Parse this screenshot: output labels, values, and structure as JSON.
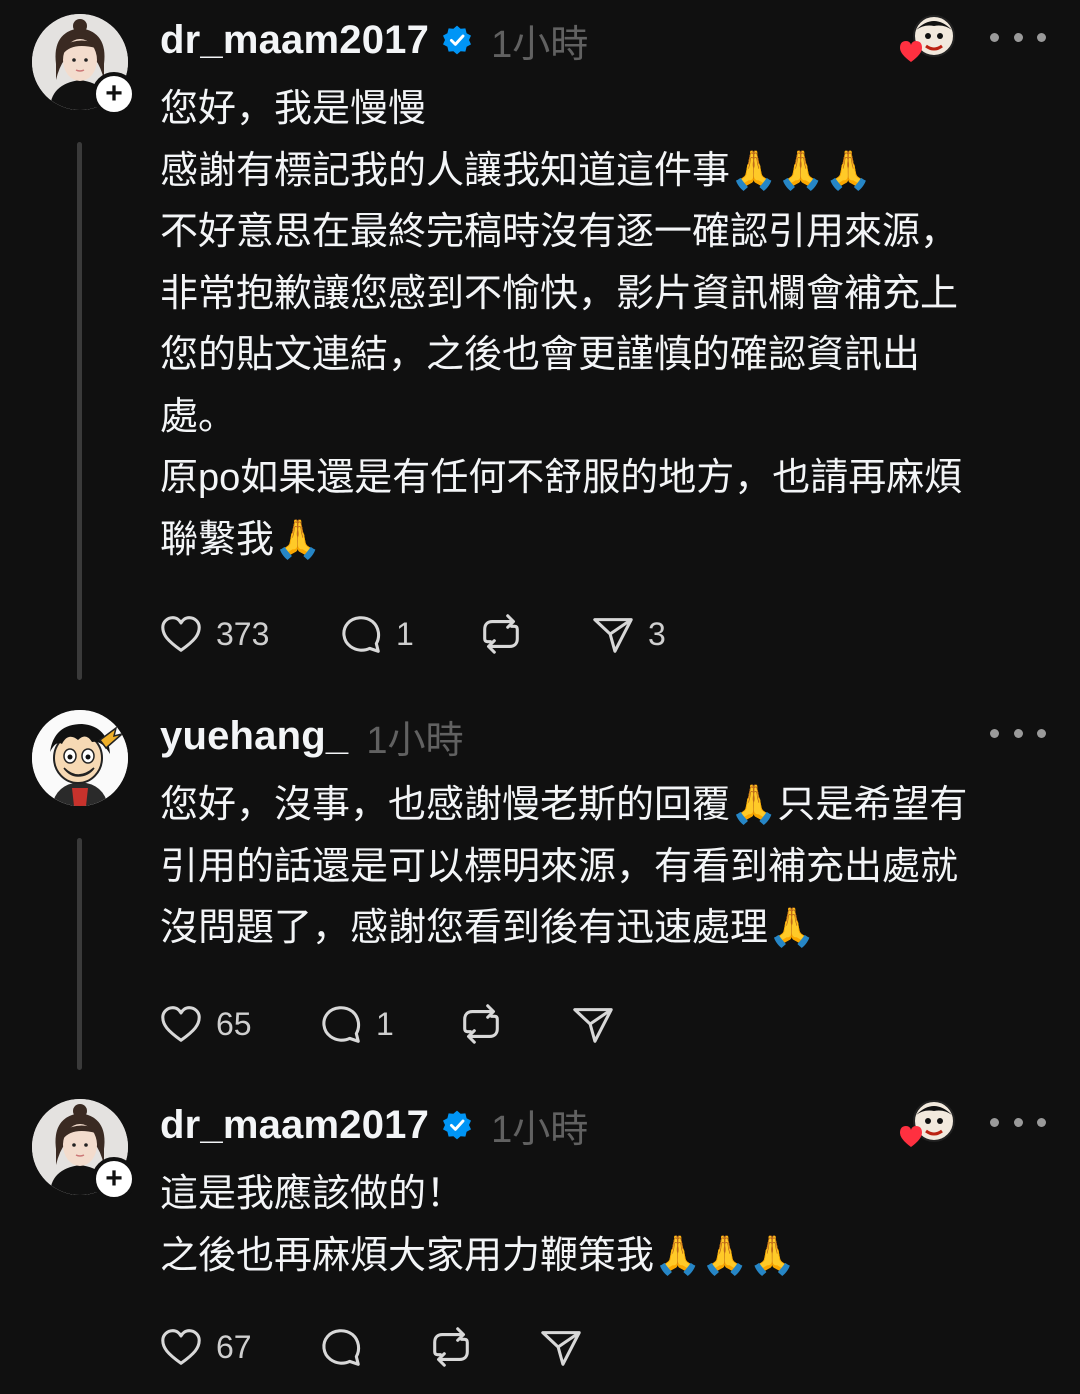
{
  "posts": [
    {
      "username": "dr_maam2017",
      "verified": true,
      "time": "1小時",
      "liked_by_author": true,
      "lines": [
        "您好，我是慢慢",
        "感謝有標記我的人讓我知道這件事🙏🙏🙏",
        "不好意思在最終完稿時沒有逐一確認引用來源，",
        "非常抱歉讓您感到不愉快，影片資訊欄會補充上",
        "您的貼文連結，之後也會更謹慎的確認資訊出",
        "處。",
        "原po如果還是有任何不舒服的地方，也請再麻煩",
        "聯繫我🙏"
      ],
      "likes": "373",
      "replies": "1",
      "reposts": "",
      "shares": "3"
    },
    {
      "username": "yuehang_",
      "verified": false,
      "time": "1小時",
      "liked_by_author": false,
      "lines": [
        "您好，沒事，也感謝慢老斯的回覆🙏只是希望有",
        "引用的話還是可以標明來源，有看到補充出處就",
        "沒問題了，感謝您看到後有迅速處理🙏"
      ],
      "likes": "65",
      "replies": "1",
      "reposts": "",
      "shares": ""
    },
    {
      "username": "dr_maam2017",
      "verified": true,
      "time": "1小時",
      "liked_by_author": true,
      "lines": [
        "這是我應該做的！",
        "之後也再麻煩大家用力鞭策我🙏🙏🙏"
      ],
      "likes": "67",
      "replies": "",
      "reposts": "",
      "shares": ""
    }
  ],
  "icons": {
    "like": "heart-outline-icon",
    "reply": "speech-bubble-icon",
    "repost": "repost-arrows-icon",
    "share": "paper-plane-icon",
    "verified": "blue-check-badge-icon",
    "more": "ellipsis-icon",
    "liked_by": "author-liked-heart-icon"
  },
  "colors": {
    "background": "#101010",
    "text": "#f3f5f7",
    "muted": "#616161",
    "verified": "#0095f6",
    "heart": "#ff3040"
  }
}
